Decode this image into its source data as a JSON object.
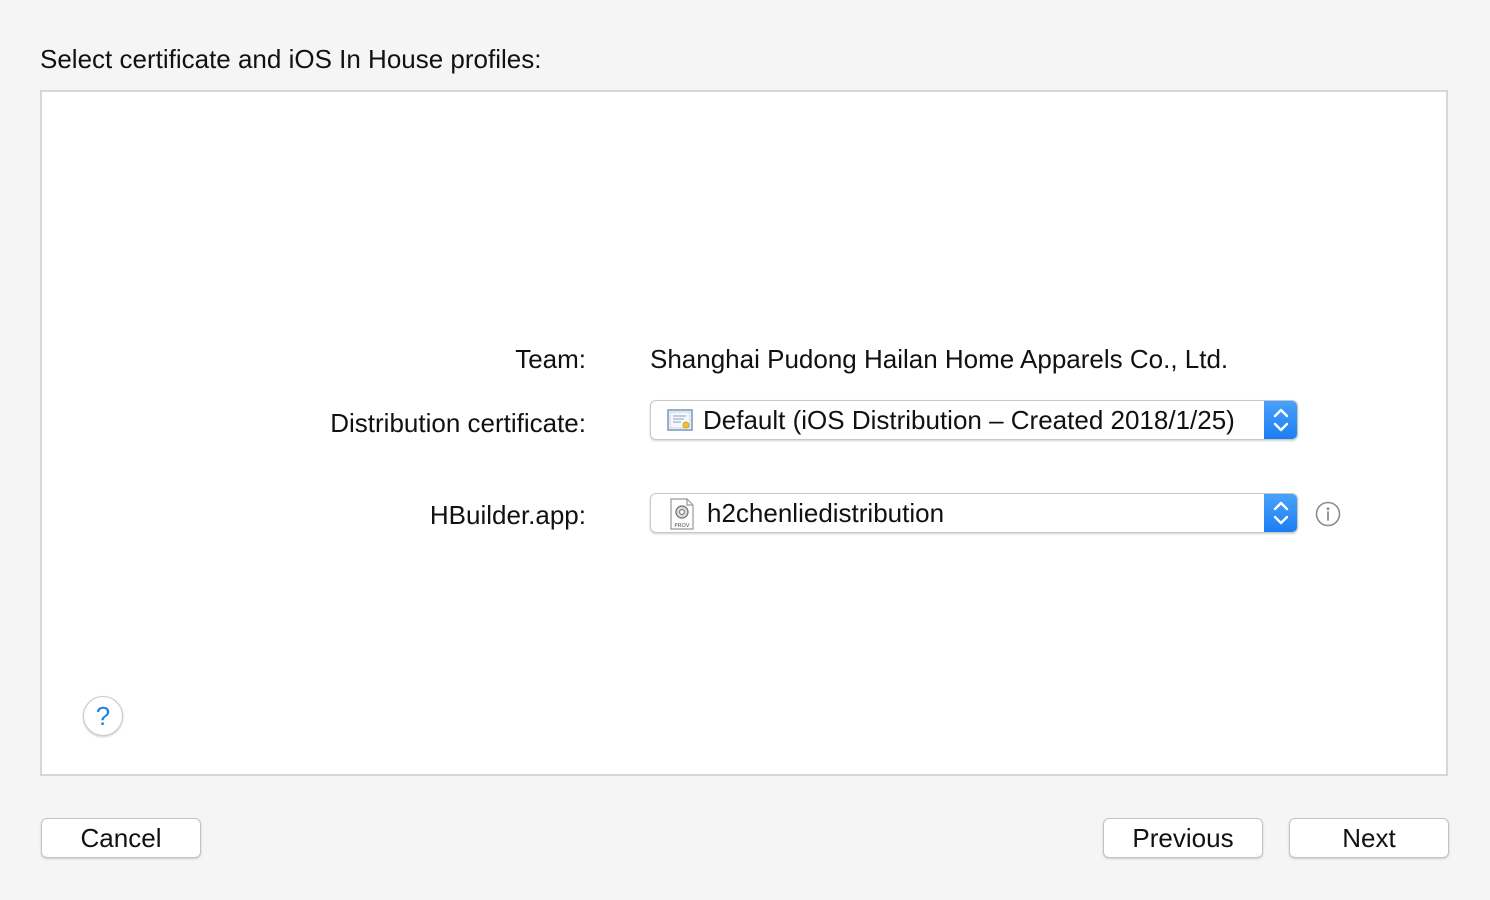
{
  "header": {
    "title": "Select certificate and iOS In House profiles:"
  },
  "form": {
    "team": {
      "label": "Team:",
      "value": "Shanghai Pudong Hailan Home Apparels Co., Ltd."
    },
    "certificate": {
      "label": "Distribution certificate:",
      "value": "Default (iOS Distribution – Created 2018/1/25)",
      "icon": "certificate-icon"
    },
    "profile": {
      "label": "HBuilder.app:",
      "value": "h2chenliedistribution",
      "icon": "provisioning-profile-icon",
      "icon_caption": "PROV"
    }
  },
  "help": {
    "label": "?"
  },
  "footer": {
    "cancel_label": "Cancel",
    "previous_label": "Previous",
    "next_label": "Next"
  },
  "colors": {
    "accent": "#1f7ff0",
    "background": "#f5f5f5",
    "panel": "#ffffff"
  }
}
